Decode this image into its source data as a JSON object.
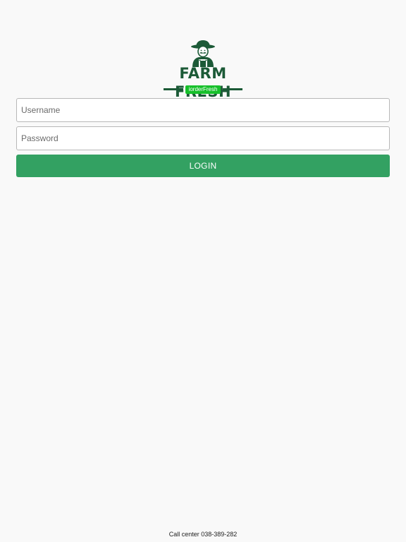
{
  "logo": {
    "wordmark": "FARM FRESH",
    "tagline": "iorderFresh",
    "brand_color": "#1c5a37",
    "tag_color": "#16c02a",
    "icon": "farmer-icon"
  },
  "login_form": {
    "username_placeholder": "Username",
    "password_placeholder": "Password",
    "login_label": "LOGIN",
    "button_color": "#33a162"
  },
  "footer": {
    "call_center": "Call center 038-389-282"
  }
}
